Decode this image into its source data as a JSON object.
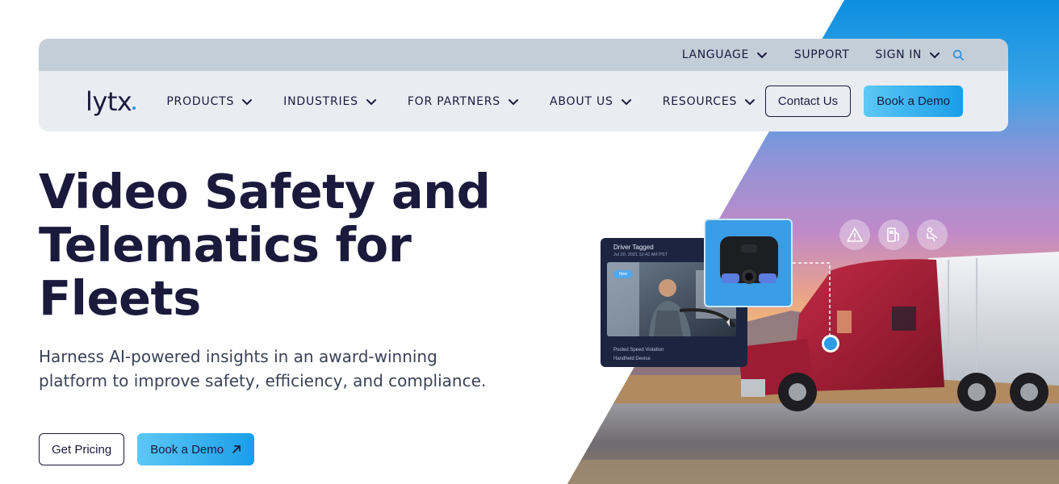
{
  "utility_nav": {
    "language": "LANGUAGE",
    "support": "SUPPORT",
    "sign_in": "SIGN IN"
  },
  "logo": {
    "text": "lytx"
  },
  "main_nav": {
    "items": [
      {
        "label": "PRODUCTS"
      },
      {
        "label": "INDUSTRIES"
      },
      {
        "label": "FOR PARTNERS"
      },
      {
        "label": "ABOUT US"
      },
      {
        "label": "RESOURCES"
      }
    ],
    "contact_label": "Contact Us",
    "demo_label": "Book a Demo"
  },
  "hero": {
    "title_line1": "Video Safety and",
    "title_line2": "Telematics for",
    "title_line3": "Fleets",
    "subtitle_line1": "Harness AI-powered insights in an award-winning",
    "subtitle_line2": "platform to improve safety, efficiency, and compliance.",
    "cta_pricing": "Get Pricing",
    "cta_demo": "Book a Demo"
  },
  "event_card": {
    "title": "Driver Tagged",
    "date": "Jul 20, 2021  12:42 AM PST",
    "badge": "New",
    "line1": "Posted Speed Violation",
    "line2": "Handheld Device"
  },
  "icons": {
    "alert": "warning-icon",
    "fuel": "fuel-pump-icon",
    "seatbelt": "seatbelt-icon",
    "search": "search-icon",
    "chevron": "chevron-down-icon",
    "arrow": "arrow-up-right-icon"
  },
  "colors": {
    "brand_navy": "#1b1a3d",
    "accent_blue": "#1a9ee8",
    "accent_light": "#5cc8f6",
    "util_bar": "#c4ced8",
    "nav_bg": "#e9edf2"
  }
}
